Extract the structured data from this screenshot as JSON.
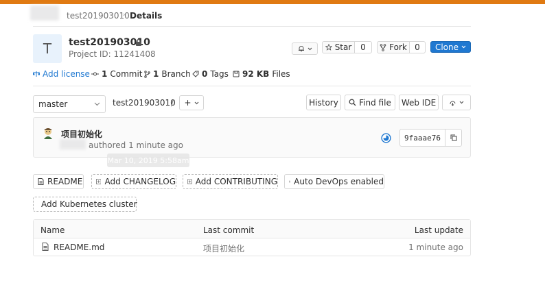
{
  "breadcrumb": {
    "project": "test201903010",
    "current": "Details"
  },
  "project": {
    "avatar_letter": "T",
    "name": "test201903010",
    "project_id": "Project ID: 11241408"
  },
  "actions": {
    "star_label": "Star",
    "star_count": "0",
    "fork_label": "Fork",
    "fork_count": "0",
    "clone_label": "Clone"
  },
  "stats": {
    "add_license": "Add license",
    "commits_count": "1",
    "commits_label": "Commit",
    "branches_count": "1",
    "branches_label": "Branch",
    "tags_count": "0",
    "tags_label": "Tags",
    "files_size": "92 KB",
    "files_label": "Files"
  },
  "tree_controls": {
    "branch": "master",
    "path": "test201903010",
    "path_sep": "/",
    "add": "+",
    "history": "History",
    "find_file": "Find file",
    "web_ide": "Web IDE"
  },
  "commit": {
    "message": "项目初始化",
    "authored": "authored 1 minute ago",
    "tooltip": "Mar 10, 2019 5:58am",
    "sha": "9faaae76"
  },
  "shortcuts": {
    "readme": "README",
    "add_changelog": "Add CHANGELOG",
    "add_contributing": "Add CONTRIBUTING",
    "auto_devops": "Auto DevOps enabled",
    "add_kubernetes": "Add Kubernetes cluster"
  },
  "file_table": {
    "headers": {
      "name": "Name",
      "last_commit": "Last commit",
      "last_update": "Last update"
    },
    "rows": [
      {
        "name": "README.md",
        "last_commit": "项目初始化",
        "last_update": "1 minute ago"
      }
    ]
  },
  "colors": {
    "accent": "#e07a12",
    "link": "#1f78d1",
    "pipeline": "#1f78d1"
  }
}
